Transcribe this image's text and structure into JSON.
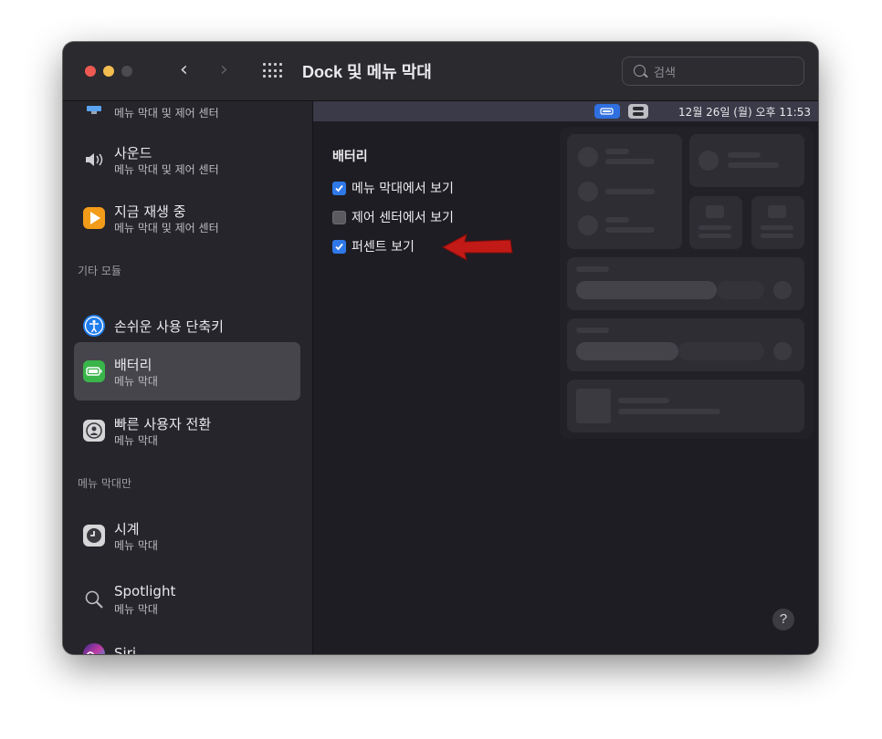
{
  "window": {
    "title": "Dock 및 메뉴 막대"
  },
  "search": {
    "placeholder": "검색"
  },
  "sidebar": {
    "items": [
      {
        "title": "",
        "subtitle": "메뉴 막대 및 제어 센터"
      },
      {
        "title": "사운드",
        "subtitle": "메뉴 막대 및 제어 센터",
        "icon": "speaker-icon"
      },
      {
        "title": "지금 재생 중",
        "subtitle": "메뉴 막대 및 제어 센터",
        "icon": "play-icon"
      },
      {
        "title": "손쉬운 사용 단축키",
        "icon": "accessibility-icon"
      },
      {
        "title": "배터리",
        "subtitle": "메뉴 막대",
        "icon": "battery-icon",
        "selected": true
      },
      {
        "title": "빠른 사용자 전환",
        "subtitle": "메뉴 막대",
        "icon": "user-switch-icon"
      },
      {
        "title": "시계",
        "subtitle": "메뉴 막대",
        "icon": "clock-icon"
      },
      {
        "title": "Spotlight",
        "subtitle": "메뉴 막대",
        "icon": "spotlight-icon"
      },
      {
        "title": "Siri",
        "icon": "siri-icon"
      }
    ],
    "sections": {
      "other": "기타 모듈",
      "menubar_only": "메뉴 막대만"
    }
  },
  "content": {
    "heading": "배터리",
    "options": [
      {
        "label": "메뉴 막대에서 보기",
        "checked": true
      },
      {
        "label": "제어 센터에서 보기",
        "checked": false
      },
      {
        "label": "퍼센트 보기",
        "checked": true
      }
    ],
    "menubar_clock": "12월 26일 (월) 오후 11:53",
    "help": "?"
  },
  "colors": {
    "accent": "#2f78e8",
    "arrow": "#c21a16"
  }
}
